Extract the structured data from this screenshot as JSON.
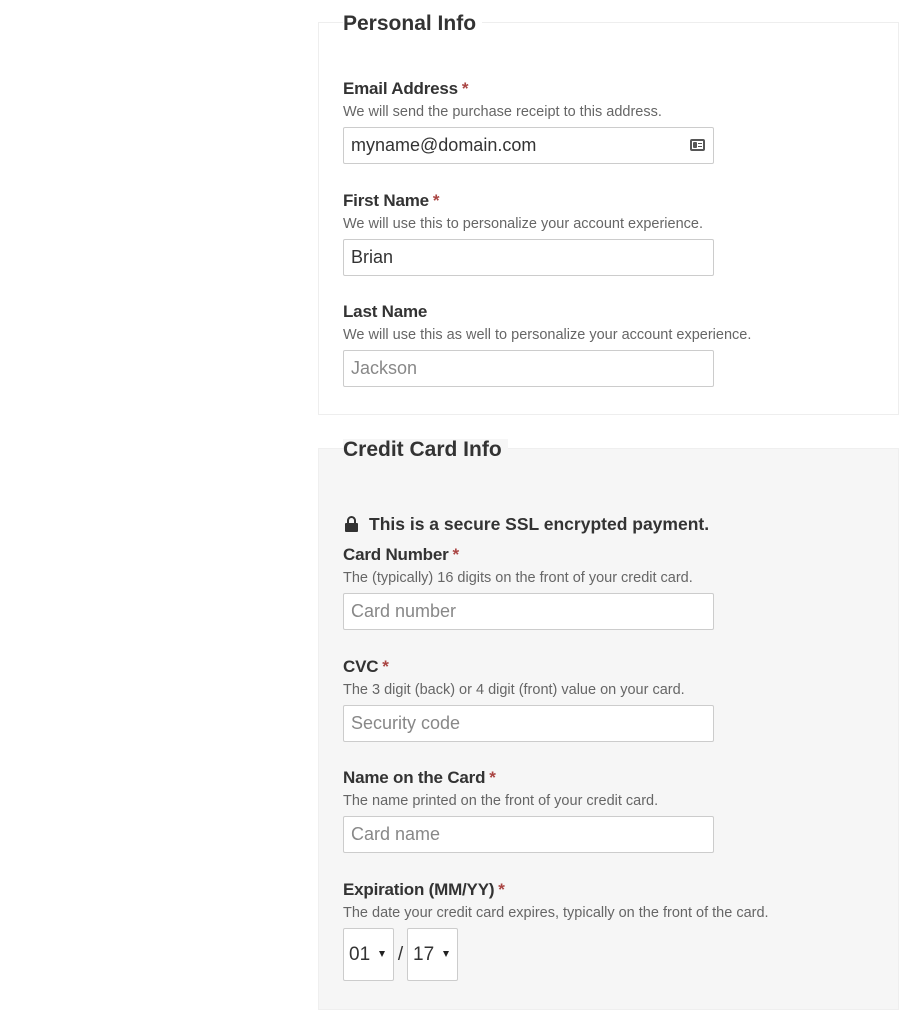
{
  "personal": {
    "legend": "Personal Info",
    "email": {
      "label": "Email Address",
      "required": "*",
      "description": "We will send the purchase receipt to this address.",
      "value": "myname@domain.com"
    },
    "first_name": {
      "label": "First Name",
      "required": "*",
      "description": "We will use this to personalize your account experience.",
      "value": "Brian"
    },
    "last_name": {
      "label": "Last Name",
      "description": "We will use this as well to personalize your account experience.",
      "placeholder": "Jackson"
    }
  },
  "card": {
    "legend": "Credit Card Info",
    "secure_note": "This is a secure SSL encrypted payment.",
    "number": {
      "label": "Card Number",
      "required": "*",
      "description": "The (typically) 16 digits on the front of your credit card.",
      "placeholder": "Card number"
    },
    "cvc": {
      "label": "CVC",
      "required": "*",
      "description": "The 3 digit (back) or 4 digit (front) value on your card.",
      "placeholder": "Security code"
    },
    "name": {
      "label": "Name on the Card",
      "required": "*",
      "description": "The name printed on the front of your credit card.",
      "placeholder": "Card name"
    },
    "expiration": {
      "label": "Expiration (MM/YY)",
      "required": "*",
      "description": "The date your credit card expires, typically on the front of the card.",
      "month": "01",
      "separator": "/",
      "year": "17"
    }
  },
  "colors": {
    "required_star": "#a94442",
    "card_section_bg": "#f6f6f6"
  }
}
